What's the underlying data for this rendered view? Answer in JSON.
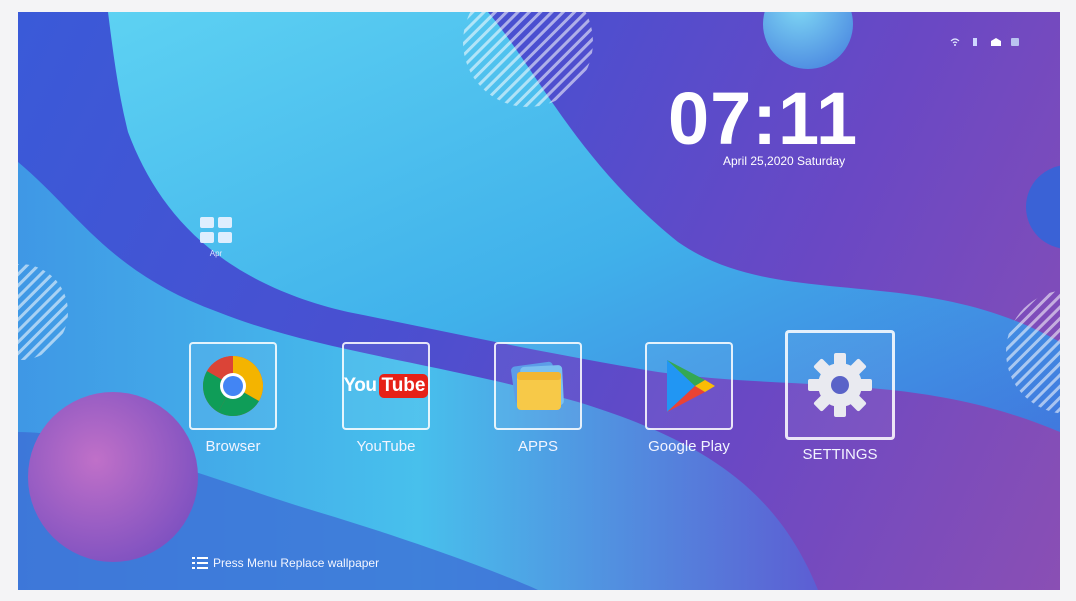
{
  "status_bar": {
    "icons": [
      "wifi-icon",
      "usb-icon",
      "ethernet-icon",
      "notification-icon"
    ]
  },
  "clock": {
    "time": "07:11",
    "date": "April 25,2020 Saturday"
  },
  "desktop_shortcut": {
    "icon": "grid-app-icon",
    "label": "Apr"
  },
  "dock": {
    "apps": [
      {
        "label": "Browser",
        "icon": "chrome-icon"
      },
      {
        "label": "YouTube",
        "icon": "youtube-icon",
        "logo_you": "You",
        "logo_tube": "Tube"
      },
      {
        "label": "APPS",
        "icon": "apps-folder-icon"
      },
      {
        "label": "Google Play",
        "icon": "google-play-icon"
      },
      {
        "label": "SETTINGS",
        "icon": "gear-icon"
      }
    ]
  },
  "footer": {
    "hint": "Press Menu Replace wallpaper",
    "icon": "menu-icon"
  },
  "colors": {
    "bg_blue": "#3a5ad8",
    "bg_purple": "#8a4fb4",
    "wave_cyan": "#4fd1f0",
    "accent_pink": "#a85ab8"
  }
}
